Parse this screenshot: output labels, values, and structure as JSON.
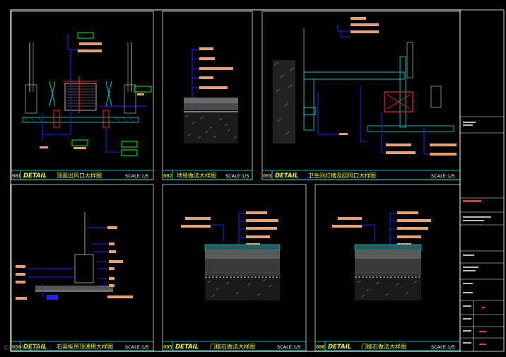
{
  "sheet": {
    "watermark": "© 土木在线"
  },
  "details": [
    {
      "num": "001",
      "tag": "DETAIL",
      "title": "顶面出风口大样图",
      "scale": "SCALE:1/5"
    },
    {
      "num": "002",
      "tag": "DETAIL",
      "title": "地毯做法大样图",
      "scale": "SCALE:1/5"
    },
    {
      "num": "003",
      "tag": "DETAIL",
      "title": "卫生间灯槽及回风口大样图",
      "scale": "SCALE:1/5"
    },
    {
      "num": "004",
      "tag": "DETAIL",
      "title": "石膏板吊顶通用大样图",
      "scale": "SCALE:1/5"
    },
    {
      "num": "005",
      "tag": "DETAIL",
      "title": "门槛石做法大样图",
      "scale": "SCALE:1/5"
    },
    {
      "num": "006",
      "tag": "DETAIL",
      "title": "门槛石做法大样图",
      "scale": "SCALE:1/5"
    }
  ],
  "colors": {
    "frame": "#ffffff",
    "title_line": "#00ffff",
    "tag_text": "#ffff00",
    "leader": "#2222ff",
    "note_bar": "#e8a070",
    "accent": "#ff2020",
    "structure": "#00c8c8",
    "hatch": "#7a7a7a"
  }
}
